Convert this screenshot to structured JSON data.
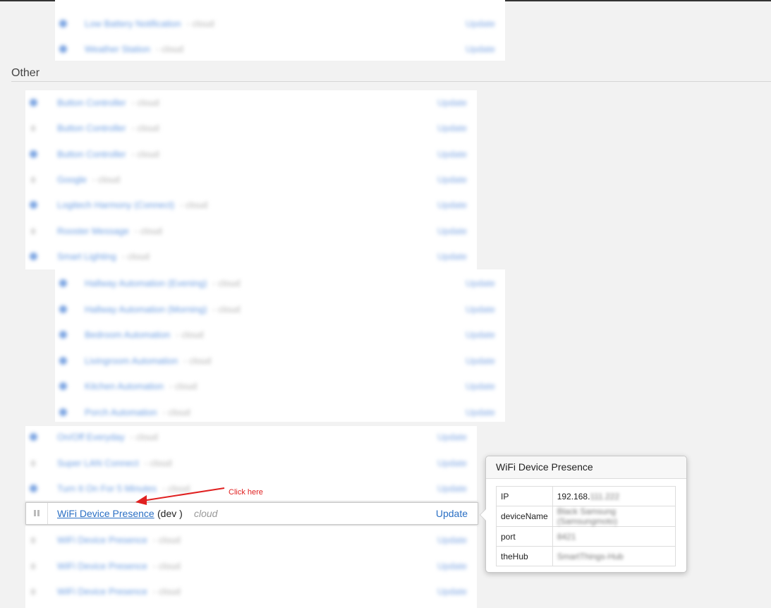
{
  "section": {
    "title": "Other"
  },
  "update_label": "Update",
  "top_panel_rows": [
    {
      "name": "Low Battery Notification",
      "meta": "cloud"
    },
    {
      "name": "Weather Station",
      "meta": "cloud"
    }
  ],
  "other_rows": [
    {
      "name": "Button Controller",
      "meta": "cloud"
    },
    {
      "name": "Button Controller",
      "meta": "cloud"
    },
    {
      "name": "Button Controller",
      "meta": "cloud"
    },
    {
      "name": "Google",
      "meta": "cloud"
    },
    {
      "name": "Logitech Harmony (Connect)",
      "meta": "cloud"
    },
    {
      "name": "Rooster Message",
      "meta": "cloud"
    },
    {
      "name": "Smart Lighting",
      "meta": "cloud"
    }
  ],
  "nested_rows": [
    {
      "name": "Hallway Automation (Evening)",
      "meta": "cloud"
    },
    {
      "name": "Hallway Automation (Morning)",
      "meta": "cloud"
    },
    {
      "name": "Bedroom Automation",
      "meta": "cloud"
    },
    {
      "name": "Livingroom Automation",
      "meta": "cloud"
    },
    {
      "name": "Kitchen Automation",
      "meta": "cloud"
    },
    {
      "name": "Porch Automation",
      "meta": "cloud"
    }
  ],
  "lower_rows": [
    {
      "name": "On/Off Everyday",
      "meta": "cloud"
    },
    {
      "name": "Super LAN Connect",
      "meta": "cloud"
    },
    {
      "name": "Turn It On For 5 Minutes",
      "meta": "cloud"
    }
  ],
  "bottom_rows": [
    {
      "name": "WiFi Device Presence",
      "meta": "cloud"
    },
    {
      "name": "WiFi Device Presence",
      "meta": "cloud"
    },
    {
      "name": "WiFi Device Presence",
      "meta": "cloud"
    }
  ],
  "highlighted": {
    "name": "WiFi Device Presence",
    "suffix": "(dev   )",
    "location": "cloud",
    "update": "Update"
  },
  "annotation": {
    "text": "Click here",
    "color": "#e02020"
  },
  "popover": {
    "title": "WiFi Device Presence",
    "rows": [
      {
        "key": "IP",
        "value": "192.168.",
        "value_blurred": "111.222"
      },
      {
        "key": "deviceName",
        "value": "",
        "value_blurred": "Black Samsung (Samsungmoto)"
      },
      {
        "key": "port",
        "value": "",
        "value_blurred": "8421"
      },
      {
        "key": "theHub",
        "value": "",
        "value_blurred": "SmartThings-Hub"
      }
    ]
  }
}
